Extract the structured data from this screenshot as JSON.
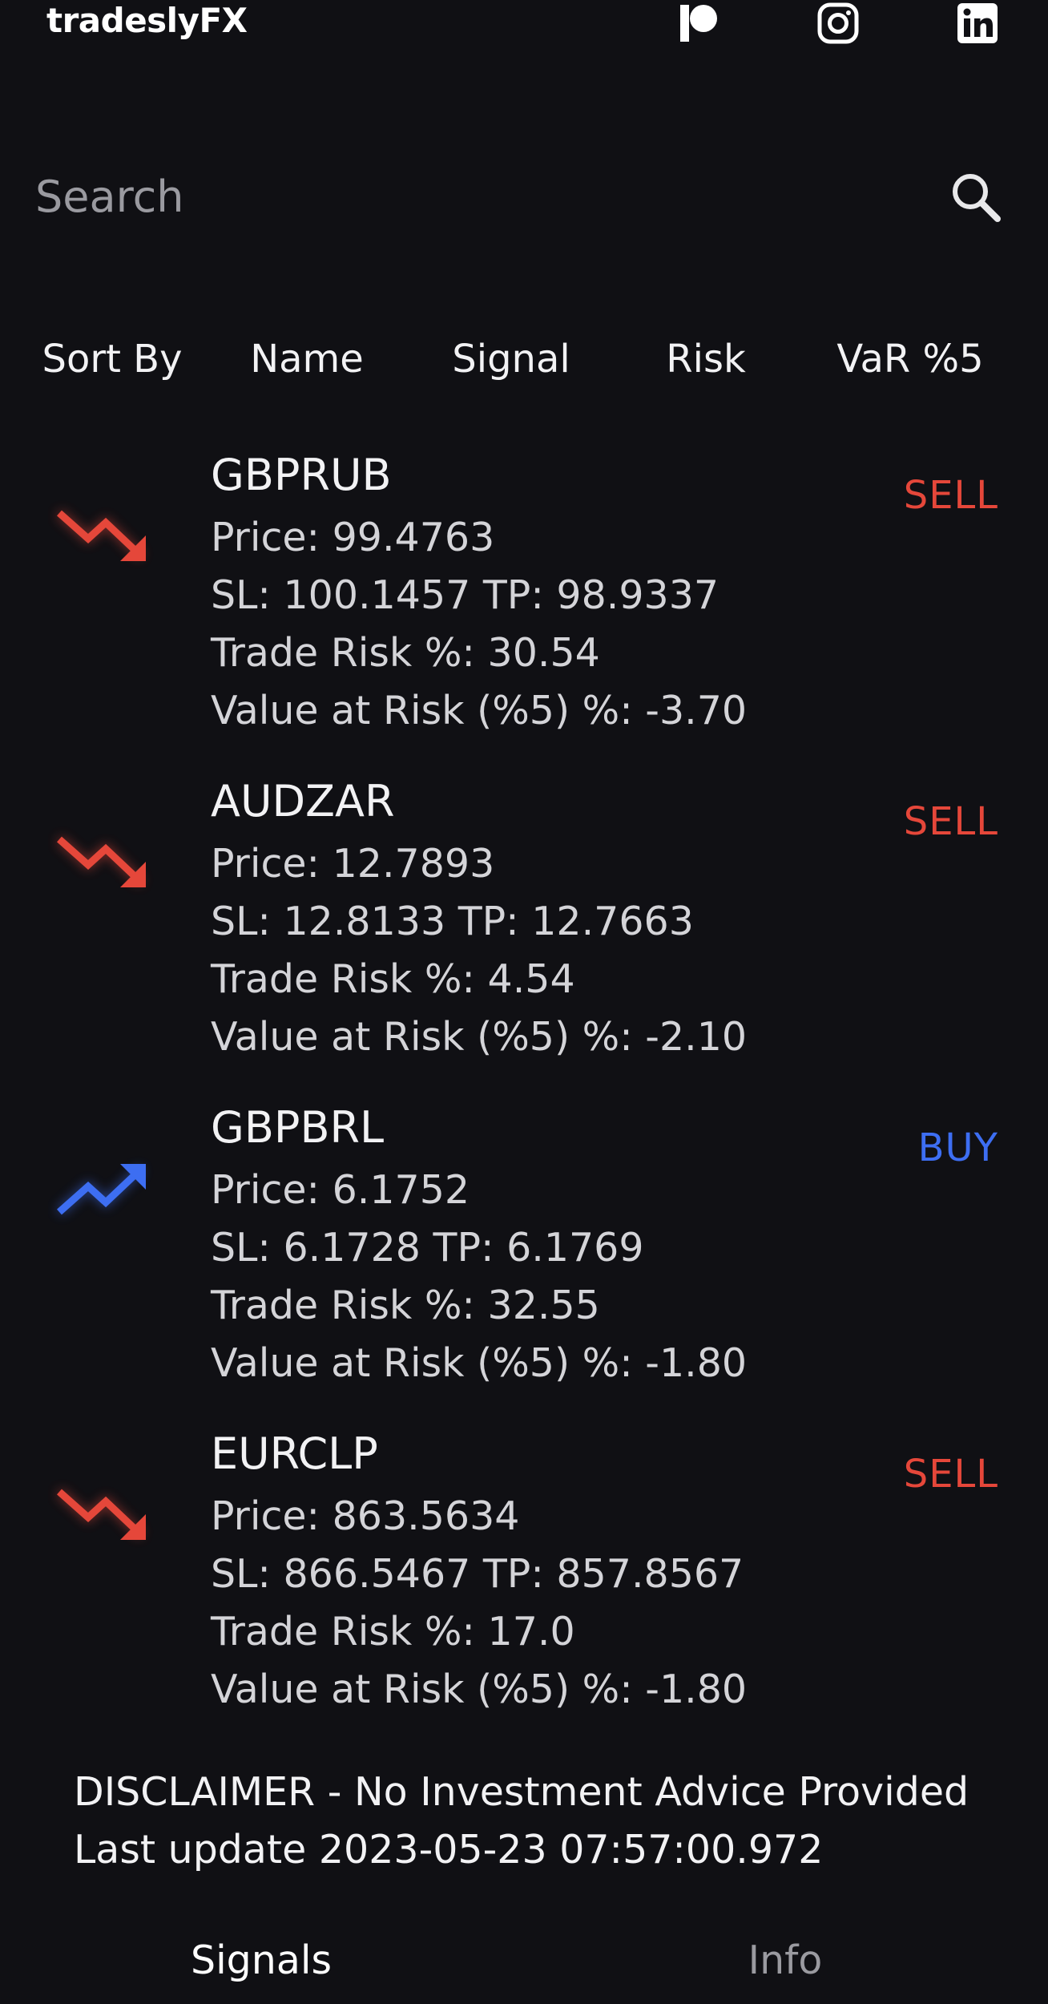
{
  "header": {
    "brand": "tradeslyFX",
    "social_icons": [
      "patreon-icon",
      "instagram-icon",
      "linkedin-icon"
    ]
  },
  "search": {
    "placeholder": "Search",
    "value": "",
    "icon": "search-icon"
  },
  "sort_bar": {
    "label": "Sort By",
    "options": [
      "Name",
      "Signal",
      "Risk",
      "VaR %5"
    ]
  },
  "signals": [
    {
      "pair": "GBPRUB",
      "price": "Price: 99.4763",
      "sl_tp": "SL: 100.1457 TP: 98.9337",
      "trade_risk": "Trade Risk %: 30.54",
      "var": "Value at Risk (%5) %: -3.70",
      "signal": "SELL",
      "trend": "down",
      "icon": "trending-down-icon"
    },
    {
      "pair": "AUDZAR",
      "price": "Price: 12.7893",
      "sl_tp": "SL: 12.8133 TP: 12.7663",
      "trade_risk": "Trade Risk %: 4.54",
      "var": "Value at Risk (%5) %: -2.10",
      "signal": "SELL",
      "trend": "down",
      "icon": "trending-down-icon"
    },
    {
      "pair": "GBPBRL",
      "price": "Price: 6.1752",
      "sl_tp": "SL: 6.1728 TP: 6.1769",
      "trade_risk": "Trade Risk %: 32.55",
      "var": "Value at Risk (%5) %: -1.80",
      "signal": "BUY",
      "trend": "up",
      "icon": "trending-up-icon"
    },
    {
      "pair": "EURCLP",
      "price": "Price: 863.5634",
      "sl_tp": "SL: 866.5467 TP: 857.8567",
      "trade_risk": "Trade Risk %: 17.0",
      "var": "Value at Risk (%5) %: -1.80",
      "signal": "SELL",
      "trend": "down",
      "icon": "trending-down-icon"
    }
  ],
  "footer": {
    "disclaimer": "DISCLAIMER - No Investment Advice Provided",
    "last_update": "Last update 2023-05-23 07:57:00.972"
  },
  "tabs": [
    {
      "label": "Signals",
      "active": true
    },
    {
      "label": "Info",
      "active": false
    }
  ],
  "colors": {
    "background": "#101014",
    "sell": "#e5473a",
    "buy": "#3d6ef2",
    "tab_active": "#ffffff",
    "tab_inactive": "#9a9aa0"
  }
}
